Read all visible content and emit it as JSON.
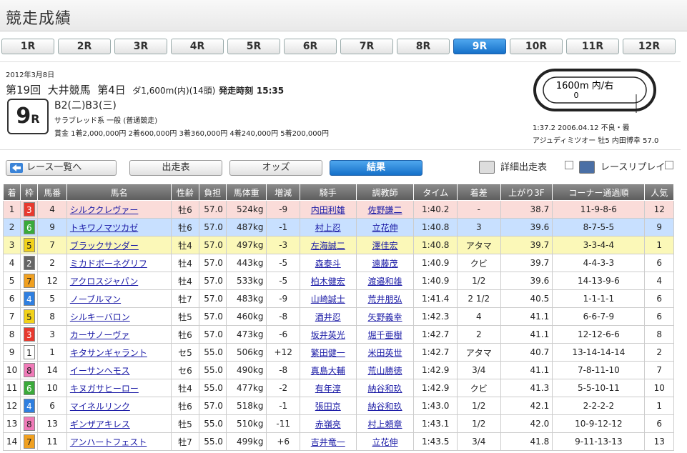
{
  "page_title": "競走成績",
  "race_tabs": [
    "1R",
    "2R",
    "3R",
    "4R",
    "5R",
    "6R",
    "7R",
    "8R",
    "9R",
    "10R",
    "11R",
    "12R"
  ],
  "active_tab": 8,
  "race": {
    "date": "2012年3月8日",
    "kai": "第19回",
    "venue": "大井競馬",
    "day": "第4日",
    "distance": "ダ1,600m(内)(14頭)",
    "start_label": "発走時刻",
    "start_time": "15:35",
    "number": "9",
    "number_suffix": "R",
    "class": "B2(二)B3(三)",
    "conditions": "サラブレッド系 一般 (普通競走)",
    "prize": "賞金 1着2,000,000円 2着600,000円 3着360,000円 4着240,000円 5着200,000円",
    "course_label": "1600m 内/右",
    "course_start": "0",
    "record_line1": "1:37.2 2006.04.12 不良・曇",
    "record_line2": "アジュディミツオー 牡5 内田博幸 57.0"
  },
  "nav": {
    "back": "レース一覧へ",
    "entries": "出走表",
    "odds": "オッズ",
    "results": "結果",
    "detail": "詳細出走表",
    "replay": "レースリプレイ"
  },
  "frame_colors": {
    "1": "#ffffff",
    "2": "#666666",
    "3": "#e8392e",
    "4": "#2f7fe0",
    "5": "#f2d21a",
    "6": "#3aaa3a",
    "7": "#f0a020",
    "8": "#f07ab8"
  },
  "frame_text_colors": {
    "1": "#222222",
    "2": "#ffffff",
    "3": "#ffffff",
    "4": "#ffffff",
    "5": "#222222",
    "6": "#ffffff",
    "7": "#222222",
    "8": "#222222"
  },
  "columns": [
    "着",
    "枠",
    "馬番",
    "馬名",
    "性齢",
    "負担",
    "馬体重",
    "増減",
    "騎手",
    "調教師",
    "タイム",
    "着差",
    "上がり3F",
    "コーナー通過順",
    "人気"
  ],
  "rows": [
    [
      "1",
      "3",
      "4",
      "シルククレヴァー",
      "牡6",
      "57.0",
      "524kg",
      "-9",
      "内田利雄",
      "佐野謙二",
      "1:40.2",
      "-",
      "38.7",
      "11-9-8-6",
      "12"
    ],
    [
      "2",
      "6",
      "9",
      "トキワノマツカゼ",
      "牡6",
      "57.0",
      "487kg",
      "-1",
      "村上忍",
      "立花伸",
      "1:40.8",
      "3",
      "39.6",
      "8-7-5-5",
      "9"
    ],
    [
      "3",
      "5",
      "7",
      "ブラックサンダー",
      "牡4",
      "57.0",
      "497kg",
      "-3",
      "左海誠二",
      "澤佳宏",
      "1:40.8",
      "アタマ",
      "39.7",
      "3-3-4-4",
      "1"
    ],
    [
      "4",
      "2",
      "2",
      "ミカドボーネグリフ",
      "牡4",
      "57.0",
      "443kg",
      "-5",
      "森泰斗",
      "遠藤茂",
      "1:40.9",
      "クビ",
      "39.7",
      "4-4-3-3",
      "6"
    ],
    [
      "5",
      "7",
      "12",
      "アクロスジャパン",
      "牡4",
      "57.0",
      "533kg",
      "-5",
      "柏木健宏",
      "渡邉和雄",
      "1:40.9",
      "1/2",
      "39.6",
      "14-13-9-6",
      "4"
    ],
    [
      "6",
      "4",
      "5",
      "ノーブルマン",
      "牡7",
      "57.0",
      "483kg",
      "-9",
      "山崎誠士",
      "荒井朋弘",
      "1:41.4",
      "2 1/2",
      "40.5",
      "1-1-1-1",
      "6"
    ],
    [
      "7",
      "5",
      "8",
      "シルキーバロン",
      "牡5",
      "57.0",
      "460kg",
      "-8",
      "酒井忍",
      "矢野義幸",
      "1:42.3",
      "4",
      "41.1",
      "6-6-7-9",
      "6"
    ],
    [
      "8",
      "3",
      "3",
      "カーサノーヴァ",
      "牡6",
      "57.0",
      "473kg",
      "-6",
      "坂井英光",
      "堀千亜樹",
      "1:42.7",
      "2",
      "41.1",
      "12-12-6-6",
      "8"
    ],
    [
      "9",
      "1",
      "1",
      "キタサンギャラント",
      "セ5",
      "55.0",
      "506kg",
      "+12",
      "繁田健一",
      "米田英世",
      "1:42.7",
      "アタマ",
      "40.7",
      "13-14-14-14",
      "2"
    ],
    [
      "10",
      "8",
      "14",
      "イーサンヘモス",
      "セ6",
      "55.0",
      "490kg",
      "-8",
      "真島大輔",
      "荒山勝徳",
      "1:42.9",
      "3/4",
      "41.1",
      "7-8-11-10",
      "7"
    ],
    [
      "11",
      "6",
      "10",
      "キヌガサヒーロー",
      "牡4",
      "55.0",
      "477kg",
      "-2",
      "有年淳",
      "納谷和玖",
      "1:42.9",
      "クビ",
      "41.3",
      "5-5-10-11",
      "10"
    ],
    [
      "12",
      "4",
      "6",
      "マイネルリンク",
      "牡6",
      "57.0",
      "518kg",
      "-1",
      "張田京",
      "納谷和玖",
      "1:43.0",
      "1/2",
      "42.1",
      "2-2-2-2",
      "1"
    ],
    [
      "13",
      "8",
      "13",
      "ギンザアキレス",
      "牡5",
      "55.0",
      "510kg",
      "-11",
      "赤嶺亮",
      "村上頼章",
      "1:43.1",
      "1/2",
      "42.0",
      "10-9-12-12",
      "6"
    ],
    [
      "14",
      "7",
      "11",
      "アンハートフェスト",
      "牡7",
      "55.0",
      "499kg",
      "+6",
      "吉井竜一",
      "立花伸",
      "1:43.5",
      "3/4",
      "41.8",
      "9-11-13-13",
      "13"
    ]
  ]
}
